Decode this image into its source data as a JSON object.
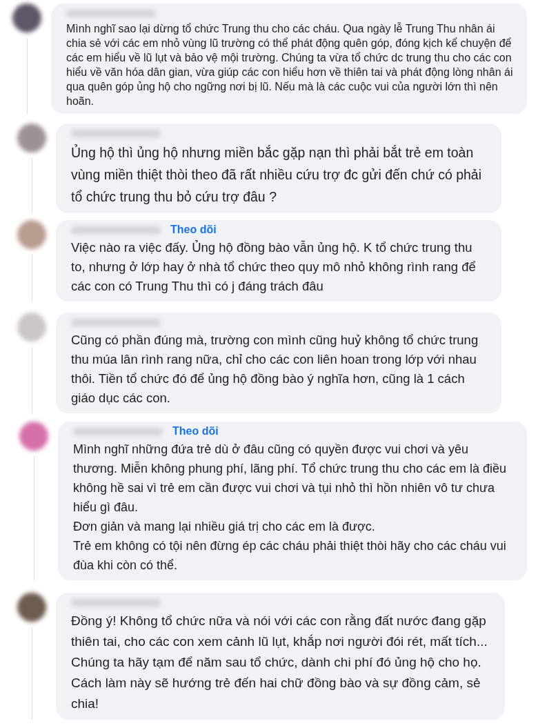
{
  "comments": [
    {
      "text": "Mình nghĩ sao lại dừng tổ chức Trung thu cho các cháu. Qua ngày lễ Trung Thu nhân ái chia sẻ với các em nhỏ vùng lũ trường có thể phát động quên góp, đóng kịch kể chuyện để các em hiểu về lũ lụt và bảo vệ mội trường. Chúng ta vừa tổ chức dc trung thu cho các con hiểu về văn hóa dân gian, vừa giúp các con hiểu hơn về thiên tai và phát động lòng nhân ái qua quên góp ủng hộ cho ngững nơi bị lũ. Nếu mà là các cuộc vui của người lớn thì nên hoãn."
    },
    {
      "text": "Ủng hộ thì ủng hộ nhưng miền bắc gặp nạn thì phải bắt trẻ em toàn vùng miền thiệt thòi theo đã rất nhiều cứu trợ đc gửi đến chứ có phải tổ chức trung thu bỏ cứu trợ đâu ?"
    },
    {
      "follow": "Theo dõi",
      "text": "Việc nào ra việc đấy. Ủng hộ đồng bào vẫn ủng hộ. K tổ chức trung thu to, nhưng ở lớp hay ở nhà tổ chức theo quy mô nhỏ không rình rang để các con có Trung Thu thì có j đáng trách đâu"
    },
    {
      "text": "Cũng có phần đúng mà, trường con mình cũng huỷ không tổ chức trung thu múa lân rình rang nữa, chỉ cho các con liên hoan trong lớp với nhau thôi. Tiền tổ chức đó để ủng hộ đồng bào ý nghĩa hơn, cũng là 1 cách giáo dục các con."
    },
    {
      "follow": "Theo dõi",
      "text": "Mình nghĩ những đứa trẻ dù ở đâu cũng có quyền được vui chơi và yêu thương. Miễn không phung phí, lãng phí. Tổ chức trung thu cho các em là điều không hề sai vì trẻ em cần được vui chơi và tụi nhỏ thì hồn nhiên vô tư chưa hiểu gì đâu.\nĐơn giản và mang lại nhiều giá trị cho các em là được.\nTrẻ em không có tội nên đừng ép các cháu phải thiệt thòi hãy cho các cháu vui đùa khi còn có thể."
    },
    {
      "text": "Đồng ý! Không tổ chức nữa và nói với các con rằng đất nước đang gặp thiên tai, cho các con xem cảnh lũ lụt, khắp nơi người đói rét, mất tích... Chúng ta hãy tạm để năm sau tổ chức, dành chi phí đó ủng hộ cho họ. Cách làm này sẽ hướng trẻ đến hai chữ đồng bào và sự đồng cảm, sẻ chia!"
    }
  ]
}
